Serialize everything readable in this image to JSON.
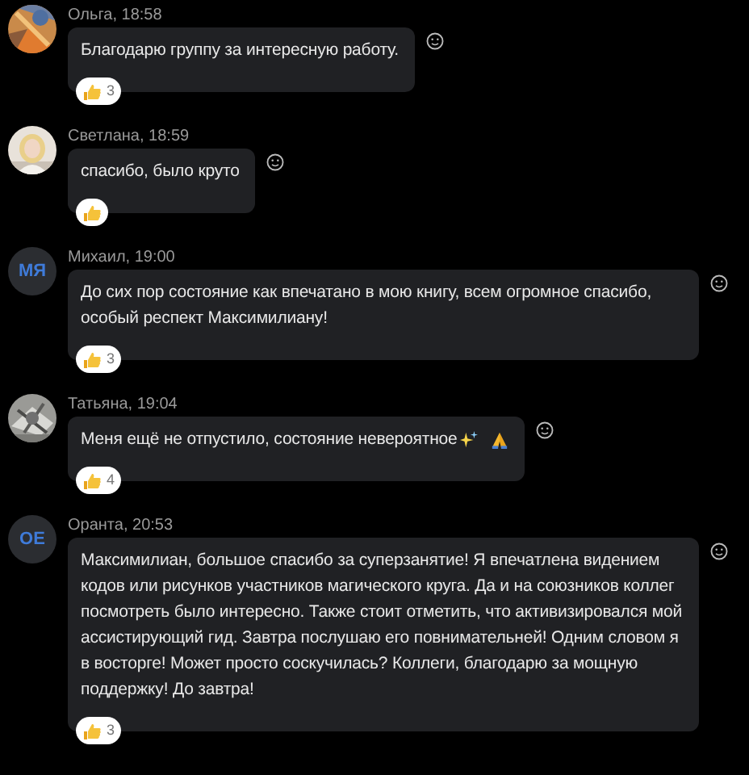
{
  "messages": [
    {
      "author": "Ольга, 18:58",
      "text": "Благодарю группу за интересную работу.",
      "reaction": {
        "kind": "thumbs-up",
        "count": "3"
      }
    },
    {
      "author": "Светлана, 18:59",
      "text": "спасибо, было круто",
      "reaction": {
        "kind": "thumbs-up"
      }
    },
    {
      "author": "Михаил, 19:00",
      "avatar": {
        "kind": "initials",
        "initials": "МЯ"
      },
      "text": "До сих пор состояние как впечатано в мою книгу, всем огромное спасибо, особый респект Максимилиану!",
      "reaction": {
        "kind": "thumbs-up",
        "count": "3"
      }
    },
    {
      "author": "Татьяна, 19:04",
      "text": "Меня ещё не отпустило, состояние невероятное",
      "emojis": [
        {
          "kind": "sparkles"
        },
        {
          "kind": "pray"
        }
      ],
      "reaction": {
        "kind": "thumbs-up",
        "count": "4"
      }
    },
    {
      "author": "Оранта, 20:53",
      "avatar": {
        "kind": "initials",
        "initials": "ОЕ"
      },
      "text": "Максимилиан, большое спасибо за суперзанятие! Я впечатлена видением кодов или рисунков участников магического круга. Да и на союзников коллег посмотреть было интересно. Также стоит отметить, что активизировался мой ассистирующий гид. Завтра послушаю его повнимательней! Одним словом я в восторге! Может просто соскучилась? Коллеги, благодарю за мощную поддержку! До завтра!",
      "reaction": {
        "kind": "thumbs-up",
        "count": "3"
      }
    }
  ]
}
